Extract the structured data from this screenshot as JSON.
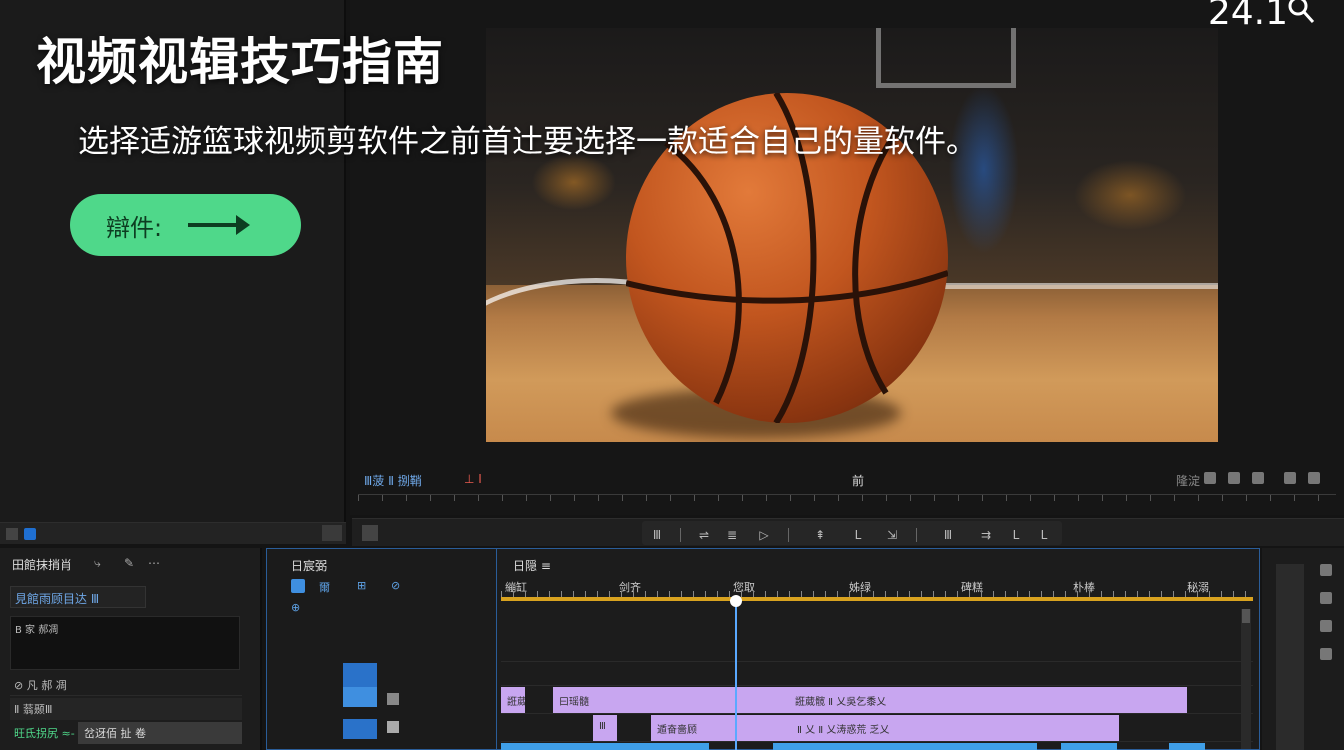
{
  "overlay": {
    "title": "视频视辑技巧指南",
    "subtitle": "选择适游篮球视频剪软件之前首辻要选择一款适合自己的量软件。",
    "button_label": "辯件:",
    "corner_text": "24.1"
  },
  "monitor": {
    "timecode_left": "Ⅲ菠 Ⅱ 捌鞘",
    "timecode_red": "⊥ Ⅰ",
    "center_label": "前",
    "right_label": "隆淀"
  },
  "transport": {
    "buttons": [
      "Ⅲ",
      "⇌",
      "≣",
      "▷",
      "⇞",
      "L",
      "⇲",
      "Ⅲ",
      "⇉",
      "L",
      "L"
    ]
  },
  "effects_panel": {
    "title": "田館抹捎肖",
    "search_value": "見館雨顾目达 Ⅲ",
    "list_item": "B 家 郝凋",
    "row1_label": "⊘ 凡 郝 凋",
    "row2_label": "Ⅱ 蓊颞Ⅲ",
    "row3_label": "旺氐拐尻 ≈-",
    "row3_value": "岔迓佰 扯 卷"
  },
  "project_panel": {
    "title": "日宸弼",
    "row_labels": [
      "爾",
      "⊞",
      "⊘",
      "⊕"
    ]
  },
  "timeline": {
    "title": "日隠 ≡",
    "ticks": [
      "繃缸",
      "剑齐",
      "您取",
      "姊绿",
      "碑糕",
      "朴棒",
      "秘溺"
    ],
    "clips_v1": [
      "誑葳",
      "曰瑶髓",
      "誑葳髋 Ⅱ 乂吳乞黍乂"
    ],
    "clips_v2": [
      "Ⅲ",
      "遁奋嗇顾",
      "Ⅱ 乂 Ⅱ 乂涛惑荒 乏乂"
    ]
  },
  "colors": {
    "accent_green": "#4fd88a",
    "timeline_purple": "#c8a6f0",
    "timeline_blue": "#3f9fe8",
    "playhead": "#5aa9ff",
    "ruler_yellow": "#d8a21f"
  }
}
